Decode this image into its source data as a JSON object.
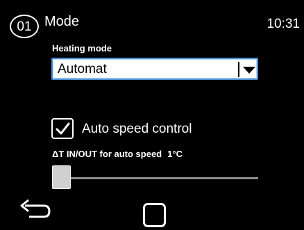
{
  "header": {
    "badge": "01",
    "title": "Mode",
    "clock": "10:31"
  },
  "heating_mode": {
    "label": "Heating mode",
    "selected": "Automat"
  },
  "auto_speed": {
    "label": "Auto speed control",
    "checked": true
  },
  "delta_t": {
    "label": "ΔT IN/OUT for auto speed",
    "value": "1°C",
    "slider_fraction": 0.0
  },
  "nav": {
    "back_icon": "back-arrow-icon",
    "home_icon": "home-square-icon"
  },
  "colors": {
    "background": "#000000",
    "text": "#ffffff",
    "accent": "#4a90d9"
  }
}
